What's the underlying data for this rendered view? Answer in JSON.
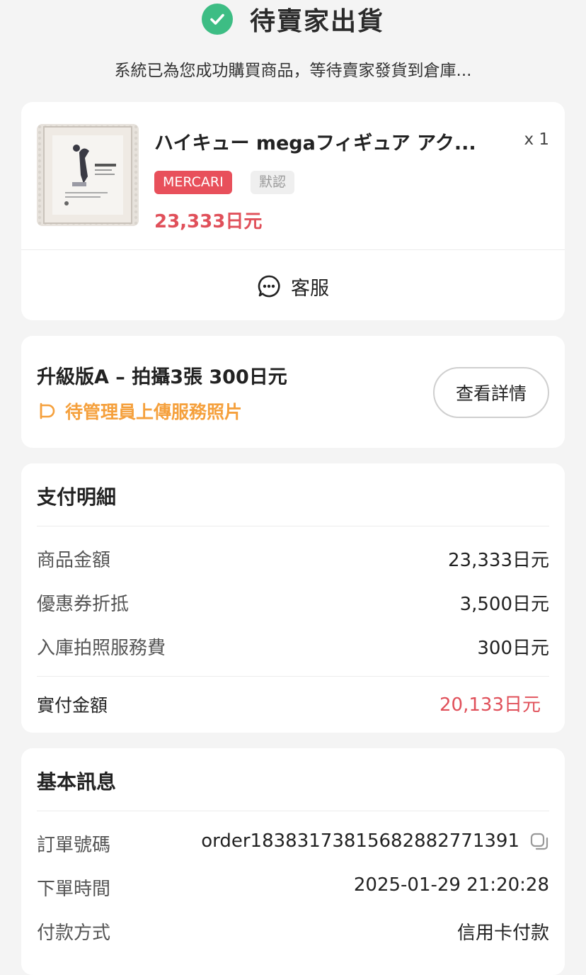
{
  "status": {
    "title": "待賣家出貨",
    "description": "系統已為您成功購買商品，等待賣家發貨到倉庫...",
    "icon": "check-circle-icon",
    "color": "#3dbd84"
  },
  "product": {
    "title": "ハイキュー megaフィギュア アク...",
    "quantity": "x 1",
    "tags": {
      "platform": "MERCARI",
      "default": "默認"
    },
    "price": "23,333日元",
    "price_color": "#e0505a"
  },
  "customer_service": {
    "label": "客服",
    "icon": "chat-bubble-icon"
  },
  "service": {
    "title": "升級版A – 拍攝3張 300日元",
    "status": "待管理員上傳服務照片",
    "status_color": "#f5a03c",
    "detail_button": "查看詳情"
  },
  "payment": {
    "title": "支付明細",
    "rows": [
      {
        "label": "商品金額",
        "value": "23,333日元"
      },
      {
        "label": "優惠券折抵",
        "value": "3,500日元"
      },
      {
        "label": "入庫拍照服務費",
        "value": "300日元"
      }
    ],
    "total": {
      "label": "實付金額",
      "value": "20,133日元"
    }
  },
  "info": {
    "title": "基本訊息",
    "rows": [
      {
        "label": "訂單號碼",
        "value": "order183831738156828827713​91"
      },
      {
        "label": "下單時間",
        "value": "2025-01-29 21:20:28"
      },
      {
        "label": "付款方式",
        "value": "信用卡付款"
      }
    ]
  }
}
